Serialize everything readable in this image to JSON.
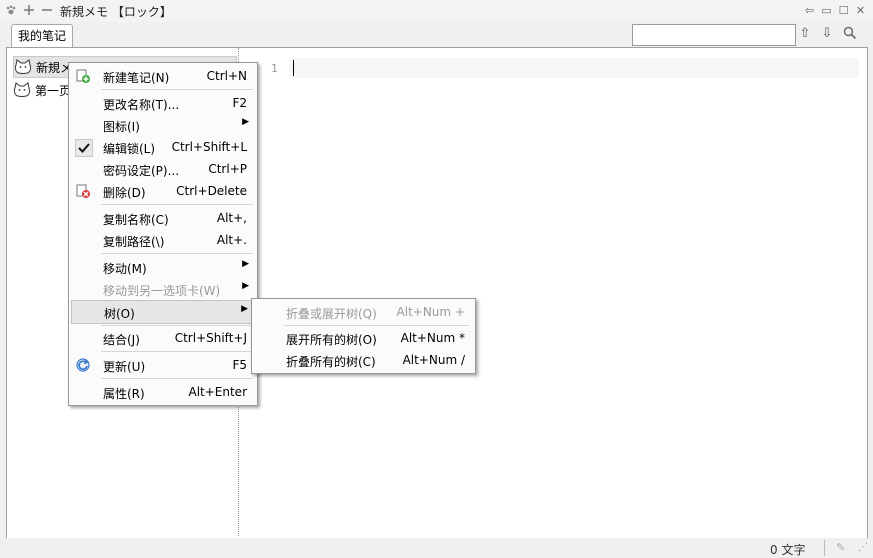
{
  "window": {
    "title": "新規メモ 【ロック】",
    "icons": [
      "paw-icon",
      "plus-icon",
      "minus-icon"
    ]
  },
  "tabs": [
    {
      "label": "我的笔记"
    }
  ],
  "search": {
    "value": "",
    "placeholder": ""
  },
  "tree": {
    "items": [
      {
        "label": "新規メモ",
        "selected": true
      },
      {
        "label": "第一页",
        "selected": false
      }
    ]
  },
  "editor": {
    "line_number": "1",
    "content": ""
  },
  "statusbar": {
    "char_count": "0 文字"
  },
  "context_menu": {
    "items": [
      {
        "label": "新建笔记(N)",
        "shortcut": "Ctrl+N",
        "icon": "add-note-icon"
      },
      {
        "label": "更改名称(T)...",
        "shortcut": "F2"
      },
      {
        "label": "图标(I)",
        "shortcut": "",
        "submenu": true
      },
      {
        "label": "编辑锁(L)",
        "shortcut": "Ctrl+Shift+L",
        "checked": true
      },
      {
        "label": "密码设定(P)...",
        "shortcut": "Ctrl+P"
      },
      {
        "label": "删除(D)",
        "shortcut": "Ctrl+Delete",
        "icon": "delete-note-icon"
      },
      {
        "label": "复制名称(C)",
        "shortcut": "Alt+,"
      },
      {
        "label": "复制路径(\\)",
        "shortcut": "Alt+."
      },
      {
        "label": "移动(M)",
        "shortcut": "",
        "submenu": true
      },
      {
        "label": "移动到另一选项卡(W)",
        "shortcut": "",
        "submenu": true,
        "disabled": true
      },
      {
        "label": "树(O)",
        "shortcut": "",
        "submenu": true,
        "active": true
      },
      {
        "label": "结合(J)",
        "shortcut": "Ctrl+Shift+J"
      },
      {
        "label": "更新(U)",
        "shortcut": "F5",
        "icon": "refresh-icon"
      },
      {
        "label": "属性(R)",
        "shortcut": "Alt+Enter"
      }
    ]
  },
  "sub_menu": {
    "items": [
      {
        "label": "折叠或展开树(Q)",
        "shortcut": "Alt+Num +",
        "disabled": true
      },
      {
        "label": "展开所有的树(O)",
        "shortcut": "Alt+Num *"
      },
      {
        "label": "折叠所有的树(C)",
        "shortcut": "Alt+Num /"
      }
    ]
  },
  "colors": {
    "menu_bg": "#fbfbfb",
    "disabled_text": "#9a9a9a",
    "accent_green": "#3aa63a",
    "delete_red": "#d23c3c",
    "refresh_blue": "#3a78c8"
  }
}
